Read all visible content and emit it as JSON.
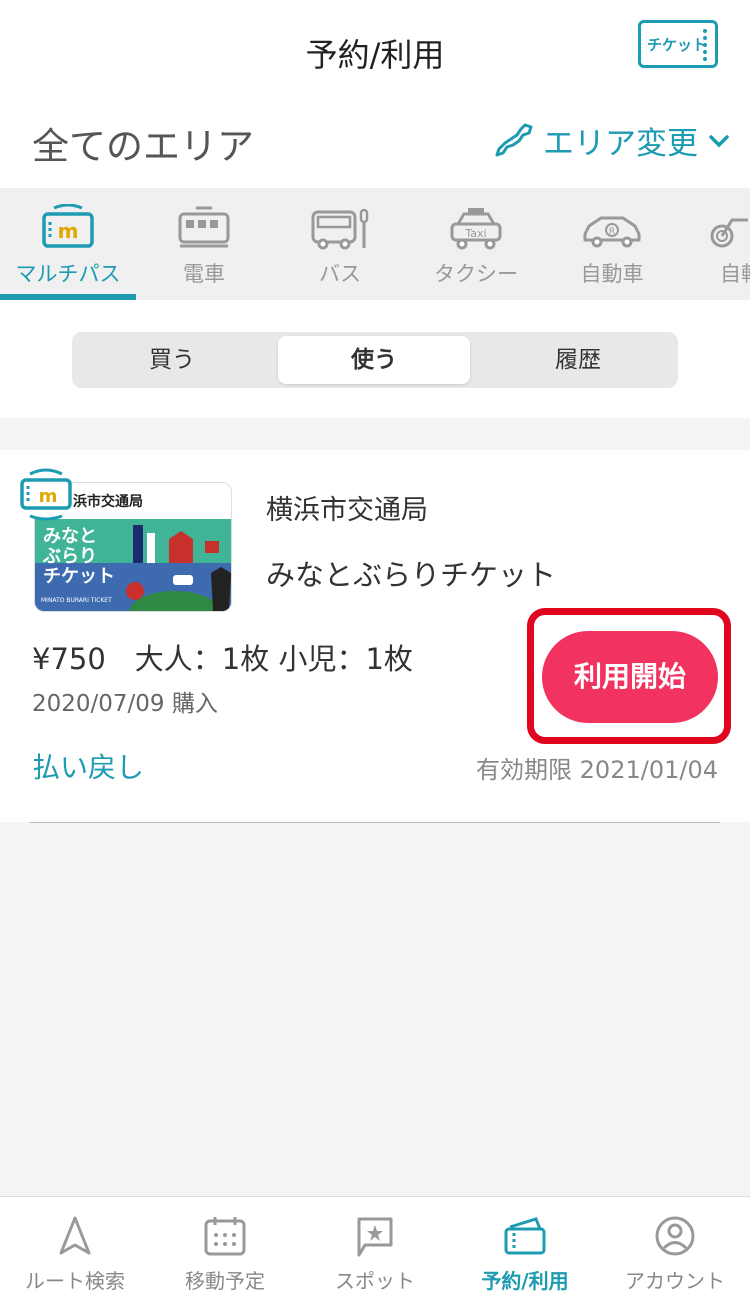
{
  "header": {
    "title": "予約/利用",
    "ticket_button_label": "チケット"
  },
  "area": {
    "title": "全てのエリア",
    "change_label": "エリア変更"
  },
  "modes": [
    {
      "label": "マルチパス",
      "icon": "multipass-icon"
    },
    {
      "label": "電車",
      "icon": "train-icon"
    },
    {
      "label": "バス",
      "icon": "bus-icon"
    },
    {
      "label": "タクシー",
      "icon": "taxi-icon"
    },
    {
      "label": "自動車",
      "icon": "car-icon"
    },
    {
      "label": "自転",
      "icon": "bicycle-icon"
    }
  ],
  "segments": {
    "buy": "買う",
    "use": "使う",
    "history": "履歴",
    "selected": "使う"
  },
  "ticket": {
    "thumb_operator": "浜市交通局",
    "thumb_name_line1": "みなと",
    "thumb_name_line2": "ぶらり",
    "thumb_name_line3": "チケット",
    "thumb_subtitle": "MINATO BURARI TICKET",
    "operator": "横浜市交通局",
    "name": "みなとぶらりチケット",
    "price": "¥750　大人：1枚 小児：1枚",
    "purchase_date": "2020/07/09 購入",
    "use_button": "利用開始",
    "refund": "払い戻し",
    "expiry": "有効期限 2021/01/04"
  },
  "tabbar": [
    {
      "label": "ルート検索",
      "icon": "navigation-arrow-icon"
    },
    {
      "label": "移動予定",
      "icon": "calendar-icon"
    },
    {
      "label": "スポット",
      "icon": "spot-flag-icon"
    },
    {
      "label": "予約/利用",
      "icon": "ticket-icon"
    },
    {
      "label": "アカウント",
      "icon": "account-icon"
    }
  ],
  "colors": {
    "accent": "#1c9bb2",
    "primary_button": "#f2325f",
    "highlight_border": "#e0061d"
  }
}
